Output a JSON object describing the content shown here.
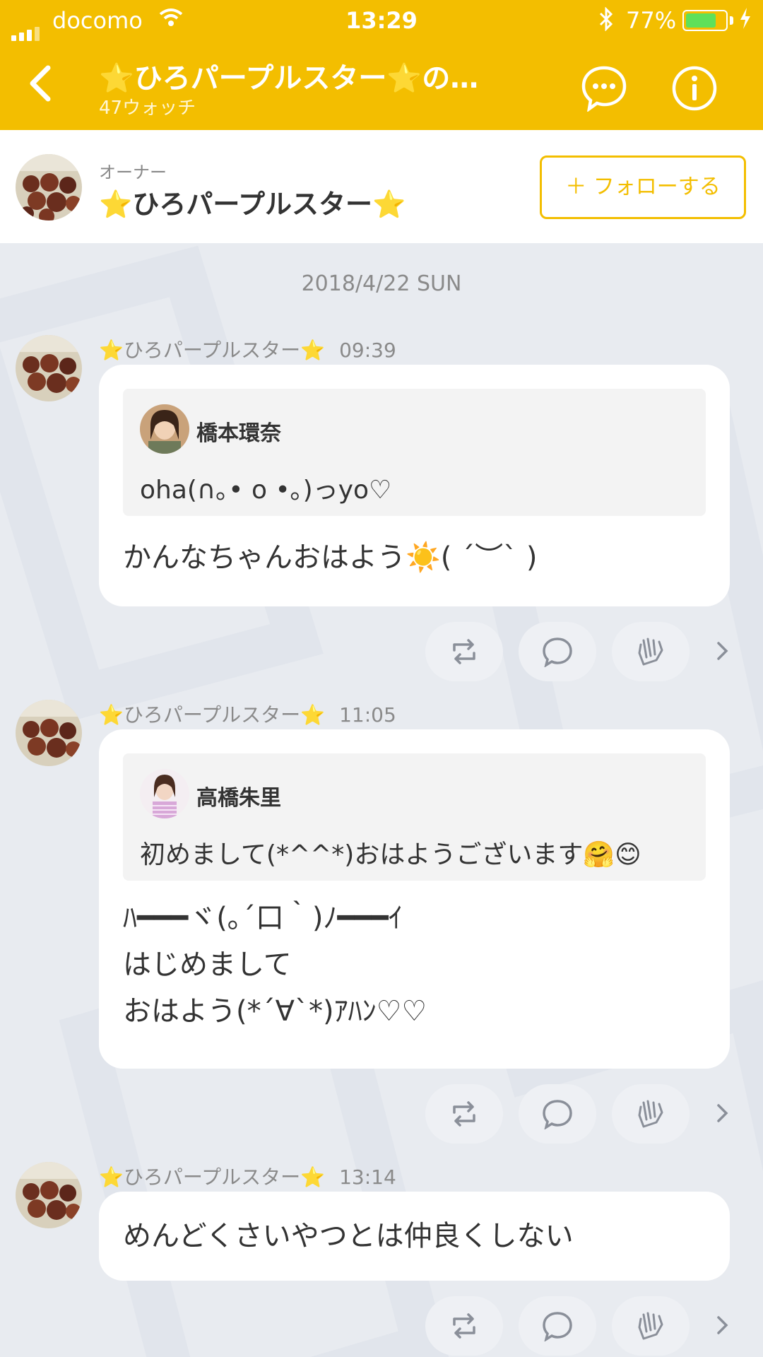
{
  "status_bar": {
    "carrier": "docomo",
    "time": "13:29",
    "battery_percent": "77%",
    "battery_level": 0.77
  },
  "header": {
    "title": "⭐ひろパープルスター⭐の…",
    "subtitle": "47ウォッチ"
  },
  "owner": {
    "role": "オーナー",
    "name": "⭐ひろパープルスター⭐",
    "follow_label": "＋ フォローする"
  },
  "timeline": {
    "date": "2018/4/22 SUN",
    "posts": [
      {
        "author": "⭐ひろパープルスター⭐",
        "time": "09:39",
        "quote": {
          "name": "橋本環奈",
          "text": "oha(∩｡• o •｡)っyo♡"
        },
        "body": [
          "かんなちゃんおはよう☀️( ´︶` )"
        ]
      },
      {
        "author": "⭐ひろパープルスター⭐",
        "time": "11:05",
        "quote": {
          "name": "高橋朱里",
          "text": "初めまして(*^^*)おはようございます🤗😊"
        },
        "body": [
          "ﾊ━━━ヾ(｡´口｀)ﾉ━━━ｲ",
          "はじめまして",
          "おはよう(*´∀`*)ｱﾊﾝ♡♡"
        ]
      },
      {
        "author": "⭐ひろパープルスター⭐",
        "time": "13:14",
        "body": [
          "めんどくさいやつとは仲良くしない"
        ]
      }
    ]
  },
  "icons": {
    "back": "chevron-left-icon",
    "chat": "speech-bubble-icon",
    "info": "info-icon",
    "repost": "repost-icon",
    "comment": "comment-icon",
    "clap": "clap-icon",
    "more": "chevron-right-icon"
  },
  "colors": {
    "brand": "#f3be00",
    "background": "#e8ebf0",
    "bubble": "#ffffff",
    "battery": "#5ee05a"
  }
}
